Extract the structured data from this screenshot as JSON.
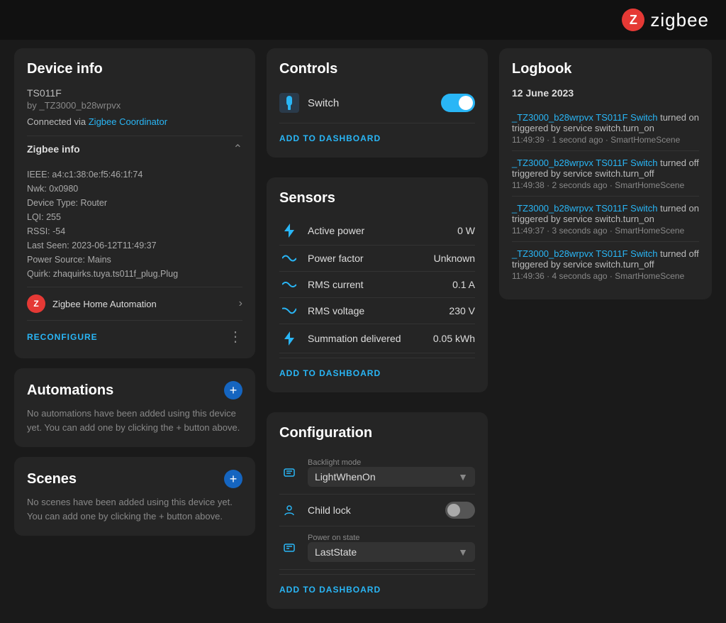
{
  "header": {
    "brand": "zigbee",
    "logo_letter": "Z"
  },
  "device_info": {
    "title": "Device info",
    "model": "TS011F",
    "by": "by _TZ3000_b28wrpvx",
    "connection_text": "Connected via ",
    "connection_link": "Zigbee Coordinator",
    "zigbee_info_title": "Zigbee info",
    "ieee": "IEEE: a4:c1:38:0e:f5:46:1f:74",
    "nwk": "Nwk: 0x0980",
    "device_type": "Device Type: Router",
    "lqi": "LQI: 255",
    "rssi": "RSSI: -54",
    "last_seen": "Last Seen: 2023-06-12T11:49:37",
    "power_source": "Power Source: Mains",
    "quirk": "Quirk: zhaquirks.tuya.ts011f_plug.Plug",
    "ha_profile": "Zigbee Home Automation",
    "reconfigure": "RECONFIGURE"
  },
  "automations": {
    "title": "Automations",
    "empty_text": "No automations have been added using this device yet. You can add one by clicking the + button above."
  },
  "scenes": {
    "title": "Scenes",
    "empty_text": "No scenes have been added using this device yet. You can add one by clicking the + button above."
  },
  "controls": {
    "title": "Controls",
    "switch_label": "Switch",
    "switch_on": true,
    "add_dashboard": "ADD TO DASHBOARD"
  },
  "sensors": {
    "title": "Sensors",
    "rows": [
      {
        "label": "Active power",
        "value": "0 W",
        "icon": "⚡"
      },
      {
        "label": "Power factor",
        "value": "Unknown",
        "icon": "⚖"
      },
      {
        "label": "RMS current",
        "value": "0.1 A",
        "icon": "〰"
      },
      {
        "label": "RMS voltage",
        "value": "230 V",
        "icon": "〜"
      },
      {
        "label": "Summation delivered",
        "value": "0.05 kWh",
        "icon": "⚡"
      }
    ],
    "add_dashboard": "ADD TO DASHBOARD"
  },
  "configuration": {
    "title": "Configuration",
    "backlight_label": "Backlight mode",
    "backlight_value": "LightWhenOn",
    "child_lock_label": "Child lock",
    "child_lock_on": false,
    "power_on_label": "Power on state",
    "power_on_value": "LastState",
    "add_dashboard": "ADD To DASHBOARD"
  },
  "logbook": {
    "title": "Logbook",
    "date": "12 June 2023",
    "entries": [
      {
        "link_text": "_TZ3000_b28wrpvx TS011F Switch",
        "action": " turned on",
        "trigger": "triggered by service switch.turn_on",
        "meta": "11:49:39 · 1 second ago · SmartHomeScene"
      },
      {
        "link_text": "_TZ3000_b28wrpvx TS011F Switch",
        "action": " turned off",
        "trigger": "triggered by service switch.turn_off",
        "meta": "11:49:38 · 2 seconds ago · SmartHomeScene"
      },
      {
        "link_text": "_TZ3000_b28wrpvx TS011F Switch",
        "action": " turned on",
        "trigger": "triggered by service switch.turn_on",
        "meta": "11:49:37 · 3 seconds ago · SmartHomeScene"
      },
      {
        "link_text": "_TZ3000_b28wrpvx TS011F Switch",
        "action": " turned off",
        "trigger": "triggered by service switch.turn_off",
        "meta": "11:49:36 · 4 seconds ago · SmartHomeScene"
      }
    ]
  }
}
